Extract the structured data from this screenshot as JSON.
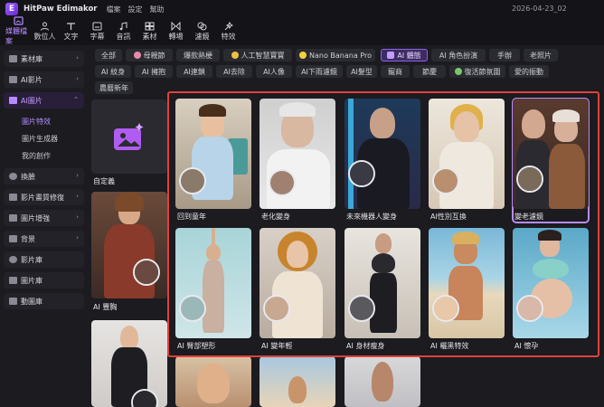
{
  "app": {
    "name": "HitPaw Edimakor",
    "logo_letter": "E",
    "menu": [
      "檔案",
      "設定",
      "幫助"
    ],
    "date": "2026-04-23_02"
  },
  "toolbar": [
    {
      "label": "媒體檔案",
      "icon": "media-icon",
      "active": true
    },
    {
      "label": "數位人",
      "icon": "avatar-icon"
    },
    {
      "label": "文字",
      "icon": "text-icon"
    },
    {
      "label": "字幕",
      "icon": "subtitle-icon"
    },
    {
      "label": "音訊",
      "icon": "audio-icon"
    },
    {
      "label": "素材",
      "icon": "asset-icon"
    },
    {
      "label": "轉場",
      "icon": "transition-icon"
    },
    {
      "label": "濾鏡",
      "icon": "filter-icon"
    },
    {
      "label": "特效",
      "icon": "effects-icon"
    }
  ],
  "sidebar": {
    "items": [
      {
        "label": "素材庫",
        "icon": "library-icon",
        "chev": "›"
      },
      {
        "label": "AI影片",
        "icon": "ai-video-icon",
        "chev": "›"
      },
      {
        "label": "AI圖片",
        "icon": "ai-image-icon",
        "chev": "⌃",
        "open": true
      },
      {
        "label": "換臉",
        "icon": "faceswap-icon",
        "chev": "›"
      },
      {
        "label": "影片畫質修復",
        "icon": "video-repair-icon",
        "chev": "›"
      },
      {
        "label": "圖片增強",
        "icon": "image-enhance-icon",
        "chev": "›"
      },
      {
        "label": "背景",
        "icon": "background-icon",
        "chev": "›"
      },
      {
        "label": "影片庫",
        "icon": "video-library-icon"
      },
      {
        "label": "圖片庫",
        "icon": "image-library-icon"
      },
      {
        "label": "動圖庫",
        "icon": "gif-library-icon"
      }
    ],
    "sub": [
      "圖片特效",
      "圖片生成器",
      "我的創作"
    ]
  },
  "chips": [
    {
      "label": "全部"
    },
    {
      "label": "母親節"
    },
    {
      "label": "爆款熱梗"
    },
    {
      "label": "人工智慧寶寶"
    },
    {
      "label": "Nano Banana Pro"
    },
    {
      "label": "AI 體態",
      "active": true
    },
    {
      "label": "AI 角色扮演"
    },
    {
      "label": "手辦"
    },
    {
      "label": "老照片"
    },
    {
      "label": "AI 紋身"
    },
    {
      "label": "AI 擁抱"
    },
    {
      "label": "AI連鎖"
    },
    {
      "label": "AI去除"
    },
    {
      "label": "AI人像"
    },
    {
      "label": "AI下雨濾鏡"
    },
    {
      "label": "AI髮型"
    },
    {
      "label": "寵商"
    },
    {
      "label": "節慶"
    },
    {
      "label": "復活節氛圍"
    },
    {
      "label": "愛的振動"
    },
    {
      "label": "農曆新年"
    }
  ],
  "left_cards": [
    {
      "label": "自定義"
    },
    {
      "label": "AI 豐胸"
    },
    {
      "label": ""
    }
  ],
  "grid": [
    {
      "label": "回到童年"
    },
    {
      "label": "老化變身"
    },
    {
      "label": "未來機器人變身"
    },
    {
      "label": "AI性別互換"
    },
    {
      "label": "變老濾鏡"
    },
    {
      "label": "AI 臀部塑形"
    },
    {
      "label": "AI 變年輕"
    },
    {
      "label": "AI 身材瘦身"
    },
    {
      "label": "AI 曬黑特效"
    },
    {
      "label": "AI 懷孕"
    }
  ],
  "colors": {
    "accent": "#b78bff",
    "highlight": "#e0413a"
  }
}
